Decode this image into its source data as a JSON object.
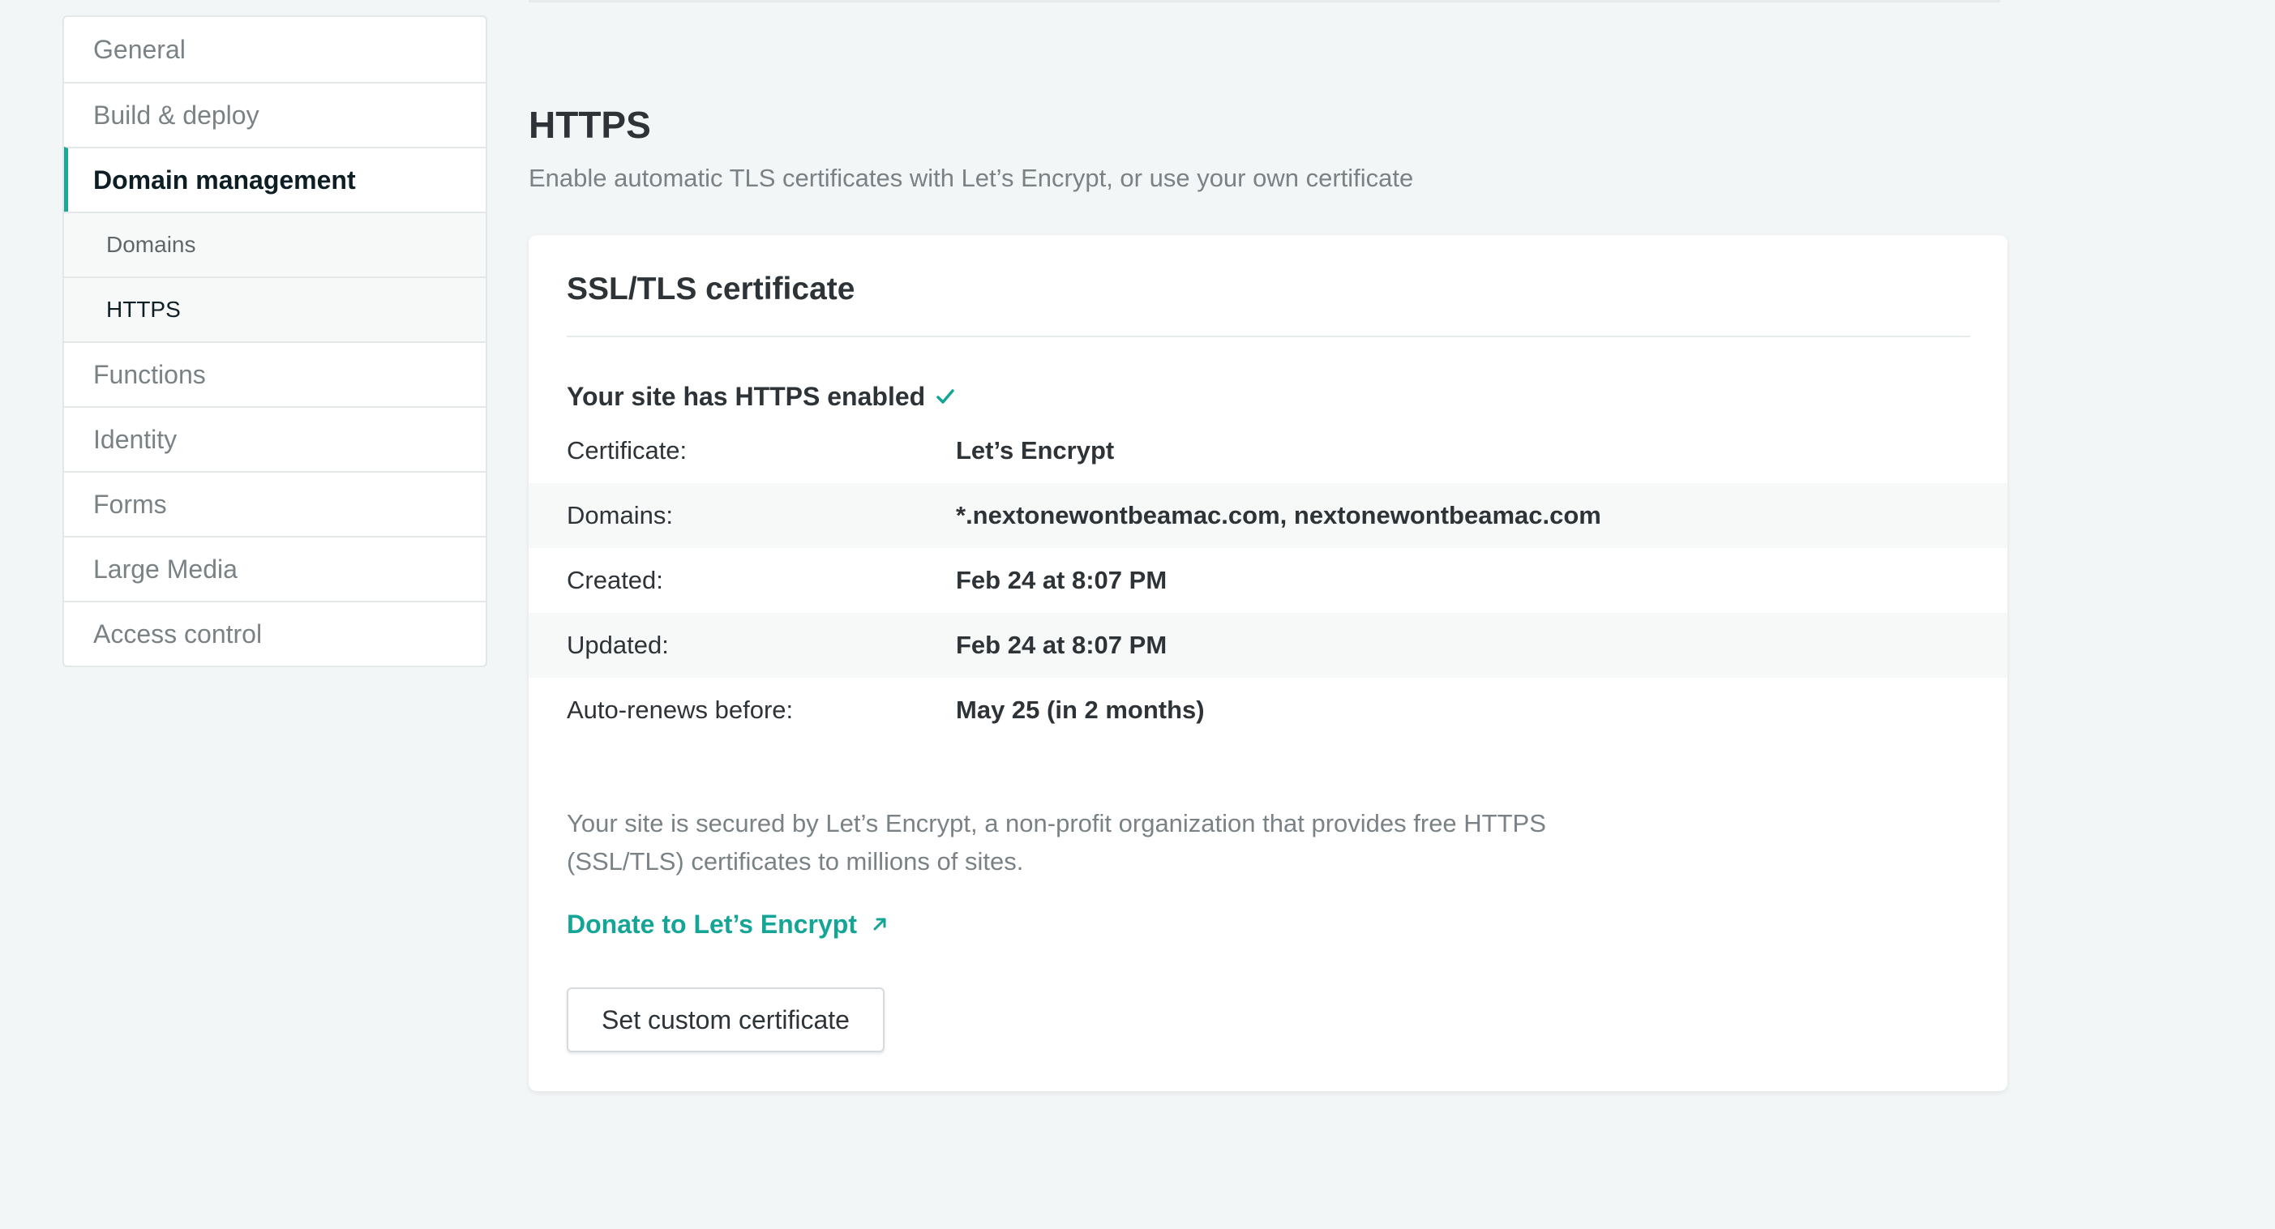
{
  "sidebar": {
    "items": [
      {
        "label": "General"
      },
      {
        "label": "Build & deploy"
      },
      {
        "label": "Domain management",
        "active": true
      },
      {
        "label": "Domains",
        "sub": true
      },
      {
        "label": "HTTPS",
        "sub": true,
        "current": true
      },
      {
        "label": "Functions"
      },
      {
        "label": "Identity"
      },
      {
        "label": "Forms"
      },
      {
        "label": "Large Media"
      },
      {
        "label": "Access control"
      }
    ]
  },
  "header": {
    "title": "HTTPS",
    "subtitle": "Enable automatic TLS certificates with Let’s Encrypt, or use your own certificate"
  },
  "card": {
    "title": "SSL/TLS certificate",
    "status": "Your site has HTTPS enabled",
    "status_icon": "check-icon",
    "details": [
      {
        "label": "Certificate:",
        "value": "Let’s Encrypt"
      },
      {
        "label": "Domains:",
        "value": "*.nextonewontbeamac.com, nextonewontbeamac.com"
      },
      {
        "label": "Created:",
        "value": "Feb 24 at 8:07 PM"
      },
      {
        "label": "Updated:",
        "value": "Feb 24 at 8:07 PM"
      },
      {
        "label": "Auto-renews before:",
        "value": "May 25 (in 2 months)"
      }
    ],
    "note": "Your site is secured by Let’s Encrypt, a non-profit organization that provides free HTTPS (SSL/TLS) certificates to millions of sites.",
    "donate_label": "Donate to Let’s Encrypt",
    "donate_icon": "external-link-icon",
    "button_label": "Set custom certificate"
  },
  "colors": {
    "accent": "#15a596",
    "background": "#f3f6f6",
    "text": "#2e3337",
    "muted": "#7a8286"
  }
}
